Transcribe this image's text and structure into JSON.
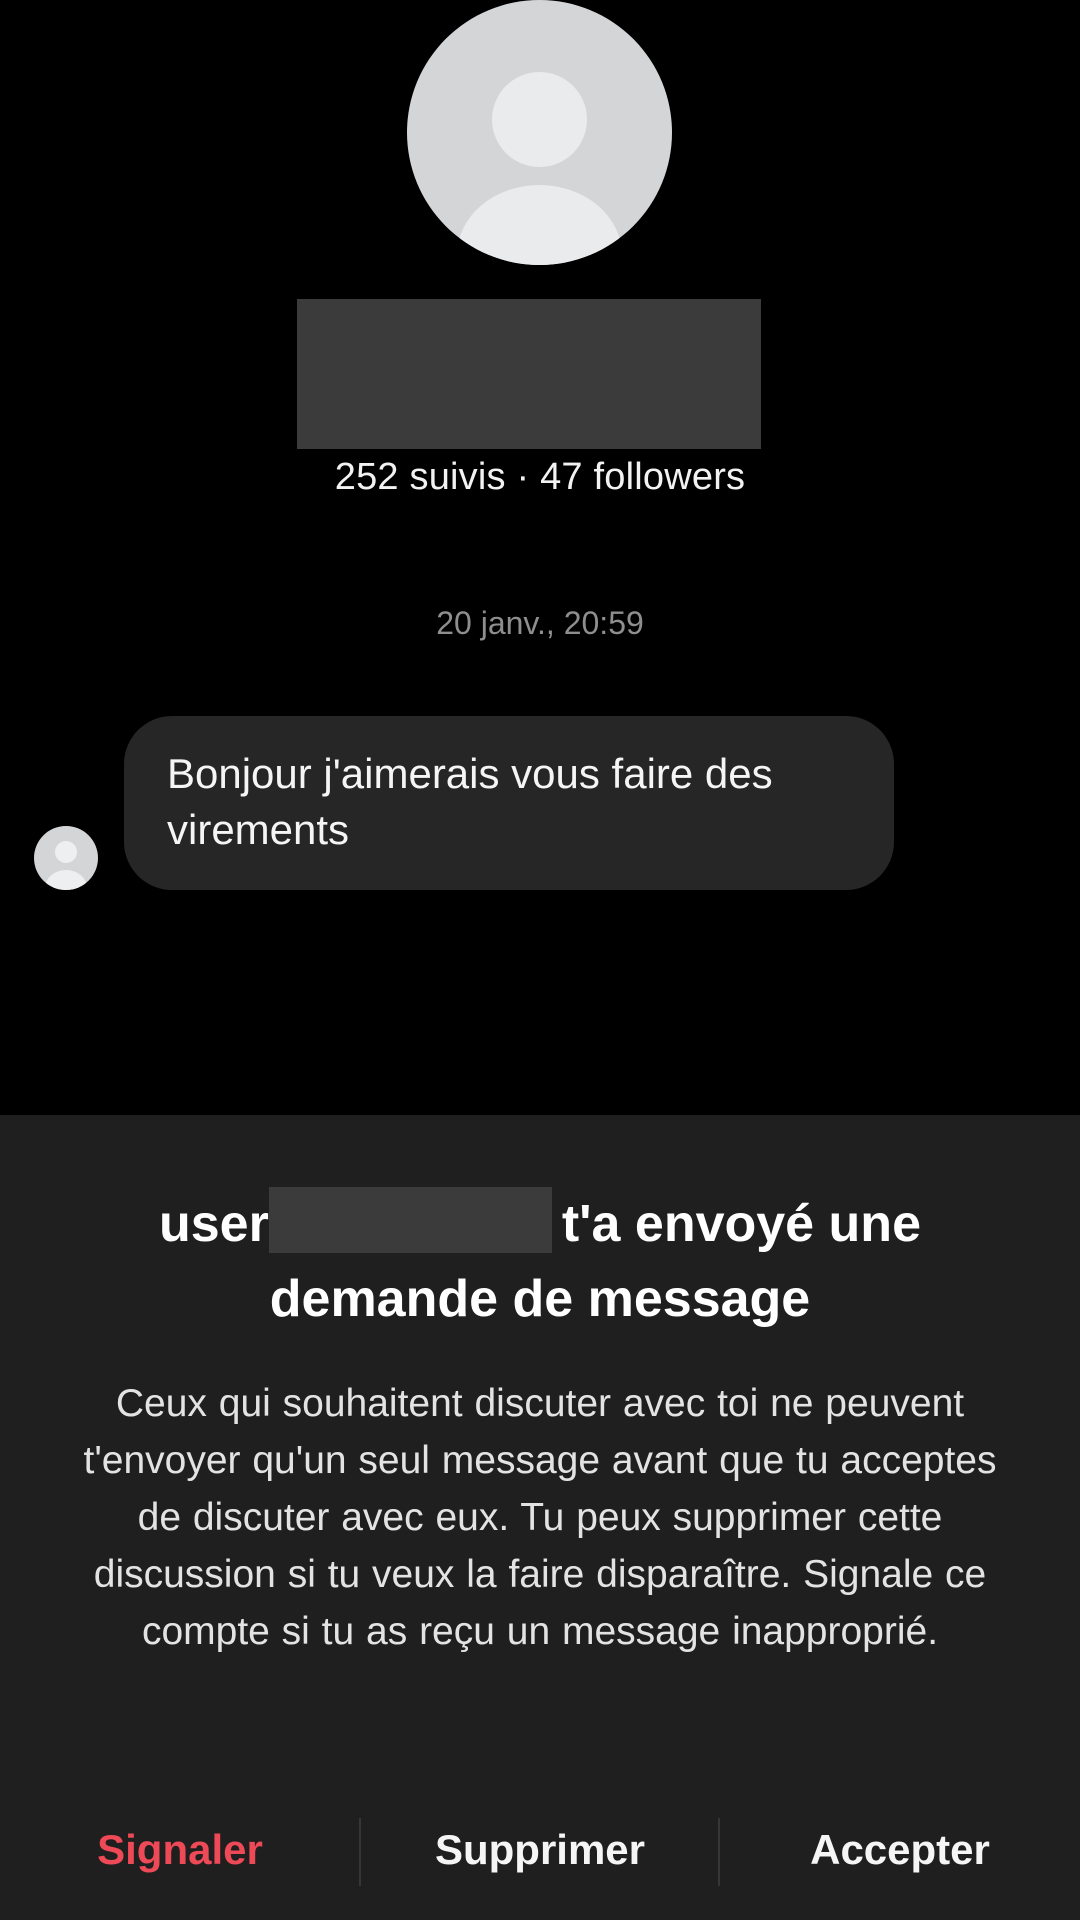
{
  "profile": {
    "follow_stats": "252 suivis · 47 followers"
  },
  "conversation": {
    "timestamp": "20 janv., 20:59",
    "messages": [
      {
        "text": "Bonjour j'aimerais vous faire des virements"
      }
    ]
  },
  "request_sheet": {
    "title_prefix": "user",
    "title_suffix": "t'a envoyé une",
    "title_line2": "demande de message",
    "description": "Ceux qui souhaitent discuter avec toi ne peuvent t'envoyer qu'un seul message avant que tu acceptes de discuter avec eux. Tu peux supprimer cette discussion si tu veux la faire disparaître. Signale ce compte si tu as reçu un message inapproprié.",
    "actions": {
      "report": "Signaler",
      "delete": "Supprimer",
      "accept": "Accepter"
    }
  },
  "colors": {
    "background": "#000000",
    "panel": "#1f1f1f",
    "bubble": "#262626",
    "danger": "#ed4956",
    "redaction": "#3b3b3b"
  },
  "icons": {
    "profile_avatar": "default-avatar-icon",
    "sender_avatar": "default-avatar-icon"
  }
}
